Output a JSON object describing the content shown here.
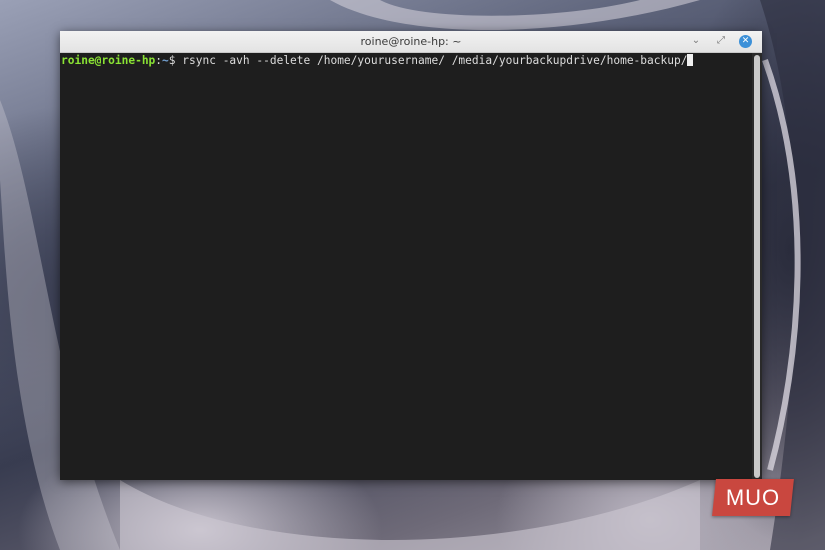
{
  "window": {
    "title": "roine@roine-hp: ~",
    "minimize_glyph": "⌄",
    "maximize_glyph": "⤢",
    "close_glyph": "✕"
  },
  "terminal": {
    "prompt_user": "roine@roine-hp",
    "prompt_separator": ":",
    "prompt_path": "~",
    "prompt_symbol": "$ ",
    "command": "rsync -avh --delete /home/yourusername/ /media/yourbackupdrive/home-backup/"
  },
  "watermark": {
    "text": "MUO"
  },
  "colors": {
    "prompt_user": "#8ae234",
    "prompt_path": "#729fcf",
    "terminal_background": "#1e1e1e",
    "close_button": "#3c90d8",
    "watermark": "#c9473f"
  },
  "icons": [
    "minimize-icon",
    "maximize-icon",
    "close-icon"
  ]
}
